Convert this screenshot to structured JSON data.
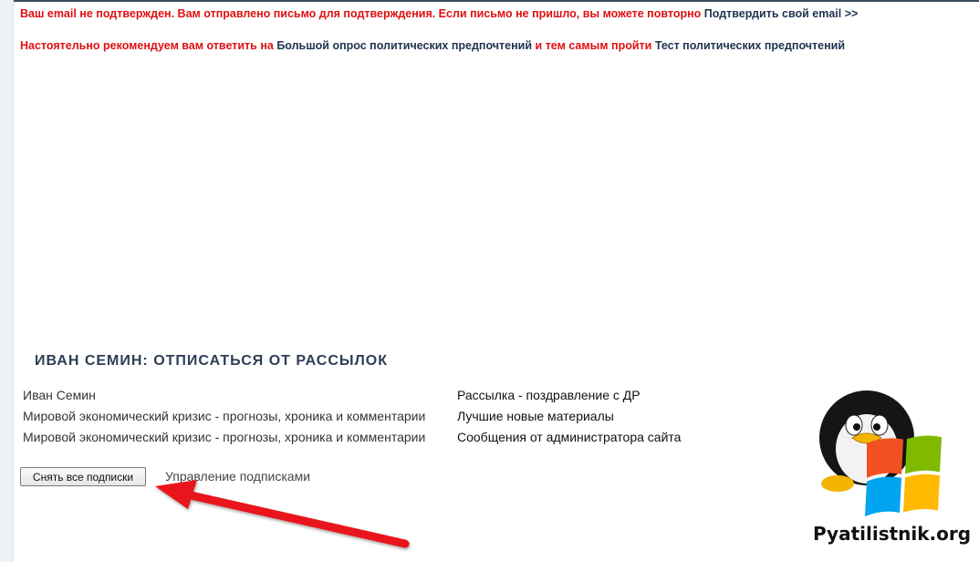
{
  "notices": {
    "email": {
      "text": "Ваш email не подтвержден. Вам отправлено письмо для подтверждения. Если письмо не пришло, вы можете повторно",
      "link": "Подтвердить свой email >>"
    },
    "survey": {
      "text_before": "Настоятельно рекомендуем вам ответить на",
      "link_survey": "Большой опрос политических предпочтений",
      "text_middle": "и тем самым пройти",
      "link_test": "Тест политических предпочтений"
    }
  },
  "unsubscribe": {
    "title": "ИВАН СЕМИН: ОТПИСАТЬСЯ ОТ РАССЫЛОК",
    "rows": [
      {
        "source": "Иван Семин",
        "mailing": "Рассылка - поздравление с ДР"
      },
      {
        "source": "Мировой экономический кризис - прогнозы, хроника и комментарии",
        "mailing": "Лучшие новые материалы"
      },
      {
        "source": "Мировой экономический кризис - прогнозы, хроника и комментарии",
        "mailing": "Сообщения от администратора сайта"
      }
    ],
    "unsubscribe_all_label": "Снять все подписки",
    "manage_label": "Управление подписками"
  },
  "watermark": {
    "text": "Pyatilistnik.org",
    "icon": "penguin-windows-logo"
  },
  "colors": {
    "alert_red": "#e01010",
    "link_dark": "#1f3350",
    "title": "#2e3d55",
    "arrow": "#e8141a"
  }
}
